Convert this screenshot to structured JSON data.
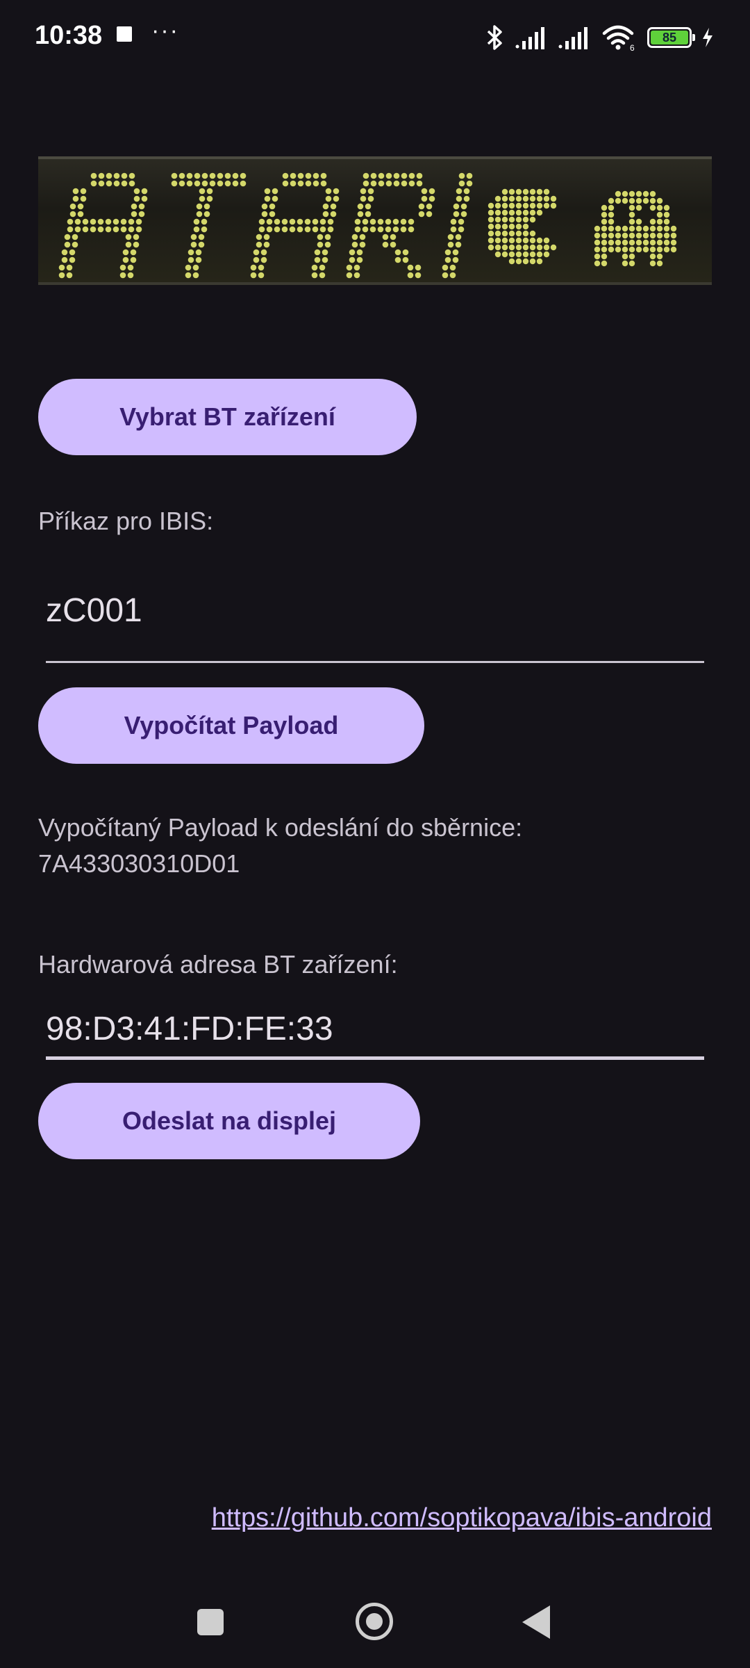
{
  "status_bar": {
    "time": "10:38",
    "battery_level": "85",
    "battery_color": "#5fd13b",
    "wifi_label": "6",
    "icons": [
      "stop-icon",
      "more-icon",
      "bluetooth-icon",
      "signal-icon",
      "signal-icon",
      "wifi-icon",
      "battery-icon",
      "charging-icon"
    ]
  },
  "banner": {
    "image_text": "ATARI",
    "dot_color": "#d4d86a",
    "icons": [
      "pacman-icon",
      "ghost-icon"
    ]
  },
  "main": {
    "select_device_button": "Vybrat BT zařízení",
    "command_label": "Příkaz pro IBIS:",
    "command_value": "zC001",
    "compute_button": "Vypočítat Payload",
    "payload_label": "Vypočítaný Payload k odeslání do sběrnice:",
    "payload_value": "7A433030310D01",
    "hw_address_label": "Hardwarová adresa BT zařízení:",
    "hw_address_value": "98:D3:41:FD:FE:33",
    "send_button": "Odeslat na displej",
    "repo_link": "https://github.com/soptikopava/ibis-android"
  },
  "colors": {
    "background": "#141218",
    "button_bg": "#d0bcff",
    "button_text": "#381e72",
    "link": "#d0bcff"
  },
  "nav_bar": {
    "icons": [
      "recent-apps-icon",
      "home-icon",
      "back-icon"
    ]
  }
}
